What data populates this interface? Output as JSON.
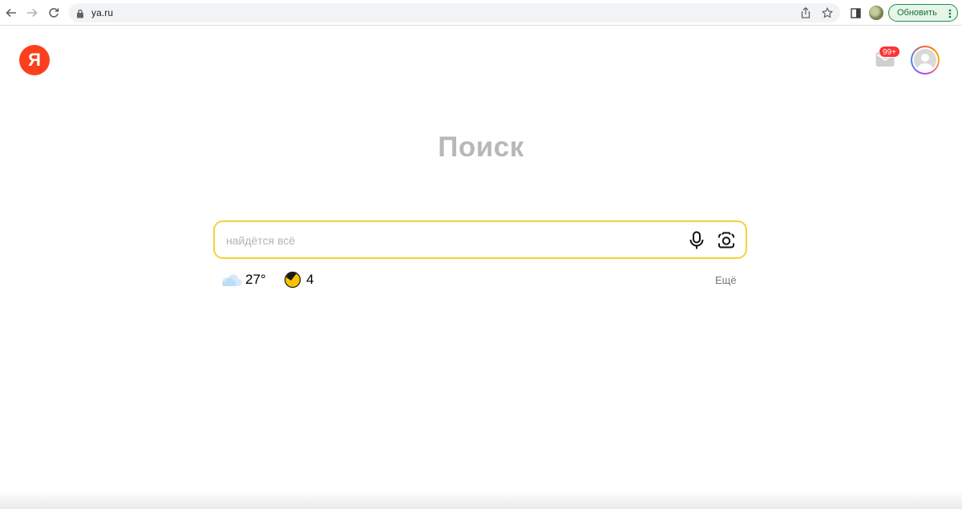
{
  "browser": {
    "url": "ya.ru",
    "update_label": "Обновить",
    "icons": {
      "back": "arrow-left-icon",
      "forward": "arrow-right-icon",
      "reload": "reload-icon",
      "lock": "lock-icon",
      "share": "share-icon",
      "bookmark": "star-icon",
      "side_panel": "side-panel-icon",
      "menu": "kebab-menu-icon"
    }
  },
  "page": {
    "logo_letter": "Я",
    "mail_badge": "99+",
    "headline": "Поиск",
    "search": {
      "placeholder": "найдётся всё"
    },
    "weather": {
      "temperature": "27°",
      "icon": "cloud-icon"
    },
    "traffic": {
      "score": "4",
      "icon": "traffic-icon"
    },
    "more_label": "Ещё"
  },
  "colors": {
    "brand_red": "#fc3f1d",
    "search_border": "#f2d437",
    "update_green": "#137333"
  }
}
